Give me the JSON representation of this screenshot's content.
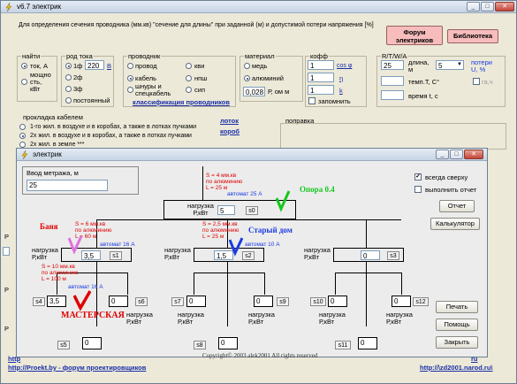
{
  "main": {
    "title": "v6.7 электрик",
    "description": "Для определения сечения проводника (мм.кв) \"сечение для длины\" при заданной (м) и допустимой потери напряжения [%]",
    "btn_forum": "Форум\nэлектриков",
    "btn_library": "Библиотека",
    "group_naiti": {
      "legend": "найти",
      "tok": "ток, А",
      "power": "мощно\nсть,\nкВт"
    },
    "group_current": {
      "legend": "род тока",
      "r1f": "1ф",
      "value": "220",
      "unit": "В",
      "r2f": "2ф",
      "r3f": "3ф",
      "const": "постоянный"
    },
    "group_conductor": {
      "legend": "проводник",
      "wire": "провод",
      "cable": "кабель",
      "busbar": "шнуры и\nспецкабель",
      "kvi": "кви",
      "nsh": "нпш",
      "sip": "сип",
      "classify": "классификация проводников"
    },
    "group_material": {
      "legend": "материал",
      "copper": "медь",
      "aluminum": "алюминий",
      "rho_value": "0,028",
      "rho_label": "Р, ом м"
    },
    "group_coeff": {
      "legend": "кофф",
      "v1": "1",
      "l1": "cos φ",
      "v2": "1",
      "l2": "η",
      "v3": "1",
      "l3": "k",
      "remember": "запомнить"
    },
    "group_rt": {
      "legend": "R/T/W/A",
      "length_val": "25",
      "length_label": "длина,\nм",
      "loss_val": "5",
      "loss_label": "потери\nU, %",
      "temp_label": "темп.Т, С°",
      "time_label": "время t, c",
      "ra_label": "ra,ч"
    },
    "laying": {
      "legend": "прокладка кабелем",
      "opt1": "1-го жил. в воздухе и в коробах, а также в лотках пучками",
      "opt2": "2х жил. в воздухе и в коробах, а также в лотках пучками",
      "opt3": "2х жил. в земле ***",
      "link_tray": "лоток",
      "link_box": "короб",
      "correction": "поправка"
    },
    "footer_left": "http://Proekt.by - форум проектировщиков",
    "footer_right": "http://\\zd2001.narod.ru\\"
  },
  "dlg": {
    "title": "электрик",
    "length_label": "Ввод метража, м",
    "length_value": "25",
    "always_on_top": "всегда сверху",
    "print_report": "выполнить отчет",
    "btn_report": "Отчет",
    "btn_calc": "Калькулятор",
    "btn_print": "Печать",
    "btn_help": "Помощь",
    "btn_close": "Закрыть",
    "copyright": "Copyright© 2003 alek2001 All rights reserved",
    "load_label": "нагрузка\nР,кВт",
    "main_load": "5",
    "s0": "s0",
    "s1": "s1",
    "s1_val": "3,5",
    "s2": "s2",
    "s2_val": "1,5",
    "s3": "s3",
    "s3_val": "0",
    "s4": "s4",
    "s4_val": "3,5",
    "s5": "s5",
    "s5_val": "0",
    "s6": "s6",
    "s6_val": "0",
    "s7": "s7",
    "s7_val": "0",
    "s8": "s8",
    "s8_val": "0",
    "s9": "s9",
    "s9_val": "0",
    "s10": "s10",
    "s10_val": "0",
    "s11": "s11",
    "s11_val": "0",
    "s12": "s12",
    "s12_val": "0",
    "note_top": "S = 4 мм.кв\nпо алюминию\nL = 25 м",
    "auto_top": "автомат 25 А",
    "opora": "Опора 0.4",
    "banya": "Баня",
    "note_banya": "S = 6 мм.кв\nпо алюминию\nL = 60 м",
    "auto_banya": "автомат 16 А",
    "stary_dom": "Старый дом",
    "note_dom": "S = 2,5 мм.кв\nпо алюминию\nL = 25 м",
    "auto_dom": "автомат 10 А",
    "note_mast": "S = 10 мм.кв\nпо алюминию\nL = 100 м",
    "auto_mast": "автомат 16 А",
    "masterskaya": "МАСТЕРСКАЯ"
  }
}
